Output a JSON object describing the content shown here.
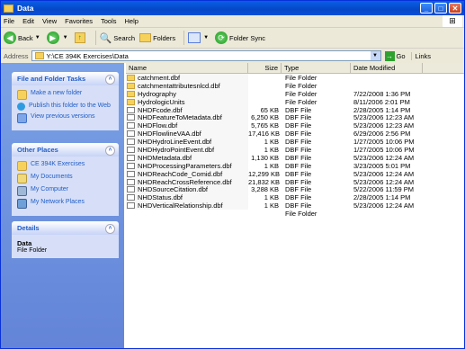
{
  "window": {
    "title": "Data"
  },
  "menu": [
    "File",
    "Edit",
    "View",
    "Favorites",
    "Tools",
    "Help"
  ],
  "toolbar": {
    "back": "Back",
    "search": "Search",
    "folders": "Folders",
    "folder_sync": "Folder Sync"
  },
  "address": {
    "label": "Address",
    "value": "Y:\\CE 394K Exercises\\Data",
    "go": "Go",
    "links": "Links"
  },
  "left": {
    "tasks_title": "File and Folder Tasks",
    "tasks": [
      "Make a new folder",
      "Publish this folder to the Web",
      "View previous versions"
    ],
    "places_title": "Other Places",
    "places": [
      "CE 394K Exercises",
      "My Documents",
      "My Computer",
      "My Network Places"
    ],
    "details_title": "Details",
    "details_name": "Data",
    "details_type": "File Folder"
  },
  "columns": {
    "name": "Name",
    "size": "Size",
    "type": "Type",
    "date": "Date Modified"
  },
  "files": [
    {
      "name": "catchment.dbf",
      "size": "",
      "type": "File Folder",
      "date": "",
      "icon": "folder"
    },
    {
      "name": "catchmentattributesnlcd.dbf",
      "size": "",
      "type": "File Folder",
      "date": "",
      "icon": "folder"
    },
    {
      "name": "Hydrography",
      "size": "",
      "type": "File Folder",
      "date": "7/22/2008 1:36 PM",
      "icon": "folder"
    },
    {
      "name": "HydrologicUnits",
      "size": "",
      "type": "File Folder",
      "date": "8/11/2006 2:01 PM",
      "icon": "folder"
    },
    {
      "name": "NHDFcode.dbf",
      "size": "65 KB",
      "type": "DBF File",
      "date": "2/28/2005 1:14 PM",
      "icon": "file"
    },
    {
      "name": "NHDFeatureToMetadata.dbf",
      "size": "6,250 KB",
      "type": "DBF File",
      "date": "5/23/2006 12:23 AM",
      "icon": "file"
    },
    {
      "name": "NHDFlow.dbf",
      "size": "5,765 KB",
      "type": "DBF File",
      "date": "5/23/2006 12:23 AM",
      "icon": "file"
    },
    {
      "name": "NHDFlowlineVAA.dbf",
      "size": "17,416 KB",
      "type": "DBF File",
      "date": "6/29/2006 2:56 PM",
      "icon": "file"
    },
    {
      "name": "NHDHydroLineEvent.dbf",
      "size": "1 KB",
      "type": "DBF File",
      "date": "1/27/2005 10:06 PM",
      "icon": "file"
    },
    {
      "name": "NHDHydroPointEvent.dbf",
      "size": "1 KB",
      "type": "DBF File",
      "date": "1/27/2005 10:06 PM",
      "icon": "file"
    },
    {
      "name": "NHDMetadata.dbf",
      "size": "1,130 KB",
      "type": "DBF File",
      "date": "5/23/2006 12:24 AM",
      "icon": "file"
    },
    {
      "name": "NHDProcessingParameters.dbf",
      "size": "1 KB",
      "type": "DBF File",
      "date": "3/23/2005 5:01 PM",
      "icon": "file"
    },
    {
      "name": "NHDReachCode_Comid.dbf",
      "size": "12,299 KB",
      "type": "DBF File",
      "date": "5/23/2006 12:24 AM",
      "icon": "file"
    },
    {
      "name": "NHDReachCrossReference.dbf",
      "size": "21,832 KB",
      "type": "DBF File",
      "date": "5/23/2006 12:24 AM",
      "icon": "file"
    },
    {
      "name": "NHDSourceCitation.dbf",
      "size": "3,288 KB",
      "type": "DBF File",
      "date": "5/22/2006 11:59 PM",
      "icon": "file"
    },
    {
      "name": "NHDStatus.dbf",
      "size": "1 KB",
      "type": "DBF File",
      "date": "2/28/2005 1:14 PM",
      "icon": "file"
    },
    {
      "name": "NHDVerticalRelationship.dbf",
      "size": "1 KB",
      "type": "DBF File",
      "date": "5/23/2006 12:24 AM",
      "icon": "file"
    },
    {
      "name": "",
      "size": "",
      "type": "File Folder",
      "date": "",
      "icon": "none"
    }
  ]
}
